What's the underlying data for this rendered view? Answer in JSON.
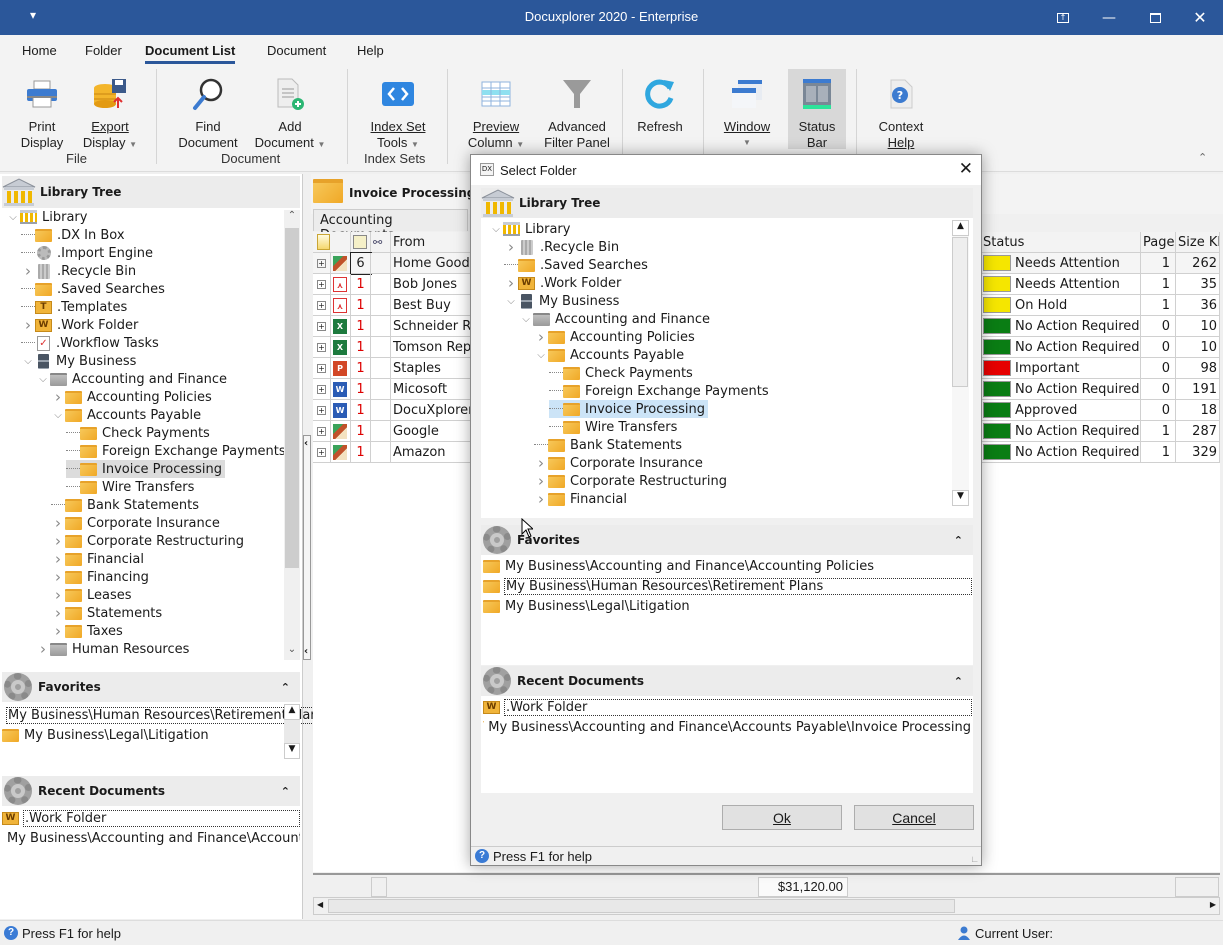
{
  "app": {
    "title": "Docuxplorer 2020 - Enterprise",
    "qat_icon": "qat-dropdown-icon"
  },
  "window_controls": [
    "restore-ribbon-icon",
    "minimize-icon",
    "maximize-icon",
    "close-icon"
  ],
  "menu_tabs": [
    {
      "label": "Home",
      "active": false
    },
    {
      "label": "Folder",
      "active": false
    },
    {
      "label": "Document List",
      "active": true
    },
    {
      "label": "Document",
      "active": false
    },
    {
      "label": "Help",
      "active": false
    }
  ],
  "ribbon": {
    "buttons": [
      {
        "line1": "Print",
        "line2": "Display",
        "icon": "printer-icon",
        "dropdown": false
      },
      {
        "line1": "Export",
        "line2": "Display",
        "icon": "export-database-icon",
        "dropdown": true
      },
      {
        "line1": "Find",
        "line2": "Document",
        "icon": "magnifier-icon",
        "dropdown": false
      },
      {
        "line1": "Add",
        "line2": "Document",
        "icon": "add-document-icon",
        "dropdown": true
      },
      {
        "line1": "Index Set",
        "line2": "Tools",
        "icon": "index-set-icon",
        "dropdown": true
      },
      {
        "line1": "Preview",
        "line2": "Column",
        "icon": "preview-column-icon",
        "dropdown": true
      },
      {
        "line1": "Advanced",
        "line2": "Filter Panel",
        "icon": "filter-icon",
        "dropdown": false
      },
      {
        "line1": "Refresh",
        "line2": "",
        "icon": "refresh-icon",
        "dropdown": false
      },
      {
        "line1": "Window",
        "line2": "",
        "icon": "window-icon",
        "dropdown": true
      },
      {
        "line1": "Status",
        "line2": "Bar",
        "icon": "status-bar-icon",
        "dropdown": false,
        "active": true
      },
      {
        "line1": "Context",
        "line2": "Help",
        "icon": "context-help-icon",
        "dropdown": false
      }
    ],
    "groups": [
      "File",
      "Document",
      "Index Sets"
    ],
    "collapse_icon": "collapse-ribbon-icon"
  },
  "left_panel": {
    "library_tree": {
      "header": "Library Tree",
      "items": [
        {
          "label": "Library",
          "level": 0,
          "expander": "open",
          "icon": "library-icon"
        },
        {
          "label": ".DX In Box",
          "level": 1,
          "expander": "none",
          "icon": "inbox-folder-icon"
        },
        {
          "label": ".Import Engine",
          "level": 1,
          "expander": "none",
          "icon": "gear-icon"
        },
        {
          "label": ".Recycle Bin",
          "level": 1,
          "expander": "closed",
          "icon": "recycle-bin-icon"
        },
        {
          "label": ".Saved Searches",
          "level": 1,
          "expander": "none",
          "icon": "saved-search-folder-icon"
        },
        {
          "label": ".Templates",
          "level": 1,
          "expander": "none",
          "icon": "templates-icon"
        },
        {
          "label": ".Work Folder",
          "level": 1,
          "expander": "closed",
          "icon": "work-folder-icon"
        },
        {
          "label": ".Workflow Tasks",
          "level": 1,
          "expander": "none",
          "icon": "workflow-tasks-icon"
        },
        {
          "label": "My Business",
          "level": 1,
          "expander": "open",
          "icon": "cabinet-icon"
        },
        {
          "label": "Accounting and Finance",
          "level": 2,
          "expander": "open",
          "icon": "drawer-icon"
        },
        {
          "label": "Accounting Policies",
          "level": 3,
          "expander": "closed",
          "icon": "folder-icon"
        },
        {
          "label": "Accounts Payable",
          "level": 3,
          "expander": "open",
          "icon": "folder-icon"
        },
        {
          "label": "Check Payments",
          "level": 4,
          "expander": "none",
          "icon": "folder-icon"
        },
        {
          "label": "Foreign Exchange Payments",
          "level": 4,
          "expander": "none",
          "icon": "folder-icon"
        },
        {
          "label": "Invoice Processing",
          "level": 4,
          "expander": "none",
          "icon": "folder-icon",
          "selected": true
        },
        {
          "label": "Wire Transfers",
          "level": 4,
          "expander": "none",
          "icon": "folder-icon"
        },
        {
          "label": "Bank Statements",
          "level": 3,
          "expander": "none",
          "icon": "folder-icon"
        },
        {
          "label": "Corporate Insurance",
          "level": 3,
          "expander": "closed",
          "icon": "folder-icon"
        },
        {
          "label": "Corporate Restructuring",
          "level": 3,
          "expander": "closed",
          "icon": "folder-icon"
        },
        {
          "label": "Financial",
          "level": 3,
          "expander": "closed",
          "icon": "folder-icon"
        },
        {
          "label": "Financing",
          "level": 3,
          "expander": "closed",
          "icon": "folder-icon"
        },
        {
          "label": "Leases",
          "level": 3,
          "expander": "closed",
          "icon": "folder-icon"
        },
        {
          "label": "Statements",
          "level": 3,
          "expander": "closed",
          "icon": "folder-icon"
        },
        {
          "label": "Taxes",
          "level": 3,
          "expander": "closed",
          "icon": "folder-icon"
        },
        {
          "label": "Human Resources",
          "level": 2,
          "expander": "closed",
          "icon": "drawer-icon"
        }
      ]
    },
    "favorites": {
      "header": "Favorites",
      "items": [
        {
          "label": "My Business\\Human Resources\\Retirement Plans",
          "focused": true
        },
        {
          "label": "My Business\\Legal\\Litigation"
        }
      ]
    },
    "recent": {
      "header": "Recent Documents",
      "items": [
        {
          "label": ".Work Folder",
          "icon": "work-folder-icon",
          "focused": true
        },
        {
          "label": "My Business\\Accounting and Finance\\Accounts Payable\\Invoice Processing",
          "icon": "folder-icon"
        }
      ]
    }
  },
  "main": {
    "folder_title": "Invoice Processing",
    "doc_tab": "Accounting Documents",
    "columns": {
      "from": "From",
      "status": "Status",
      "pages": "Pages",
      "size": "Size Kb"
    },
    "rows": [
      {
        "icon": "image-file-icon",
        "count": "6",
        "from": "Home Goods",
        "status": "Needs Attention",
        "color": "#f5e600",
        "pages": "1",
        "size": "262"
      },
      {
        "icon": "pdf-file-icon",
        "count": "1",
        "from": "Bob Jones",
        "status": "Needs Attention",
        "color": "#f5e600",
        "pages": "1",
        "size": "35"
      },
      {
        "icon": "pdf-file-icon",
        "count": "1",
        "from": "Best Buy",
        "status": "On Hold",
        "color": "#f5e600",
        "pages": "1",
        "size": "36"
      },
      {
        "icon": "excel-file-icon",
        "count": "1",
        "from": "Schneider Repair",
        "status": "No Action Required",
        "color": "#0a7d14",
        "pages": "0",
        "size": "10"
      },
      {
        "icon": "excel-file-icon",
        "count": "1",
        "from": "Tomson Repair",
        "status": "No Action Required",
        "color": "#0a7d14",
        "pages": "0",
        "size": "10"
      },
      {
        "icon": "powerpoint-file-icon",
        "count": "1",
        "from": "Staples",
        "status": "Important",
        "color": "#e60000",
        "pages": "0",
        "size": "98"
      },
      {
        "icon": "word-file-icon",
        "count": "1",
        "from": "Micosoft",
        "status": "No Action Required",
        "color": "#0a7d14",
        "pages": "0",
        "size": "191"
      },
      {
        "icon": "word-file-icon",
        "count": "1",
        "from": "DocuXplorer",
        "status": "Approved",
        "color": "#0a7d14",
        "pages": "0",
        "size": "18"
      },
      {
        "icon": "image-file-icon",
        "count": "1",
        "from": "Google",
        "status": "No Action Required",
        "color": "#0a7d14",
        "pages": "1",
        "size": "287"
      },
      {
        "icon": "image-file-icon",
        "count": "1",
        "from": "Amazon",
        "status": "No Action Required",
        "color": "#0a7d14",
        "pages": "1",
        "size": "329"
      }
    ],
    "footer_total": "$31,120.00"
  },
  "dialog": {
    "title": "Select Folder",
    "tree_header": "Library Tree",
    "tree": [
      {
        "label": "Library",
        "level": 0,
        "expander": "open",
        "icon": "library-icon"
      },
      {
        "label": ".Recycle Bin",
        "level": 1,
        "expander": "closed",
        "icon": "recycle-bin-icon"
      },
      {
        "label": ".Saved Searches",
        "level": 1,
        "expander": "none",
        "icon": "saved-search-folder-icon"
      },
      {
        "label": ".Work Folder",
        "level": 1,
        "expander": "closed",
        "icon": "work-folder-icon"
      },
      {
        "label": "My Business",
        "level": 1,
        "expander": "open",
        "icon": "cabinet-icon"
      },
      {
        "label": "Accounting and Finance",
        "level": 2,
        "expander": "open",
        "icon": "drawer-icon"
      },
      {
        "label": "Accounting Policies",
        "level": 3,
        "expander": "closed",
        "icon": "folder-icon"
      },
      {
        "label": "Accounts Payable",
        "level": 3,
        "expander": "open",
        "icon": "folder-icon"
      },
      {
        "label": "Check Payments",
        "level": 4,
        "expander": "none",
        "icon": "folder-icon"
      },
      {
        "label": "Foreign Exchange Payments",
        "level": 4,
        "expander": "none",
        "icon": "folder-icon"
      },
      {
        "label": "Invoice Processing",
        "level": 4,
        "expander": "none",
        "icon": "folder-icon",
        "selected": true
      },
      {
        "label": "Wire Transfers",
        "level": 4,
        "expander": "none",
        "icon": "folder-icon"
      },
      {
        "label": "Bank Statements",
        "level": 3,
        "expander": "none",
        "icon": "folder-icon"
      },
      {
        "label": "Corporate Insurance",
        "level": 3,
        "expander": "closed",
        "icon": "folder-icon"
      },
      {
        "label": "Corporate Restructuring",
        "level": 3,
        "expander": "closed",
        "icon": "folder-icon"
      },
      {
        "label": "Financial",
        "level": 3,
        "expander": "closed",
        "icon": "folder-icon"
      }
    ],
    "favorites_header": "Favorites",
    "favorites": [
      {
        "label": "My Business\\Accounting and Finance\\Accounting Policies"
      },
      {
        "label": "My Business\\Human Resources\\Retirement Plans",
        "focused": true
      },
      {
        "label": "My Business\\Legal\\Litigation"
      }
    ],
    "recent_header": "Recent Documents",
    "recent": [
      {
        "label": ".Work Folder",
        "icon": "work-folder-icon",
        "focused": true
      },
      {
        "label": "My Business\\Accounting and Finance\\Accounts Payable\\Invoice Processing",
        "icon": "folder-icon"
      }
    ],
    "ok_label": "Ok",
    "cancel_label": "Cancel",
    "status": "Press F1 for help"
  },
  "statusbar": {
    "help": "Press F1 for help",
    "user_label": "Current User:"
  }
}
